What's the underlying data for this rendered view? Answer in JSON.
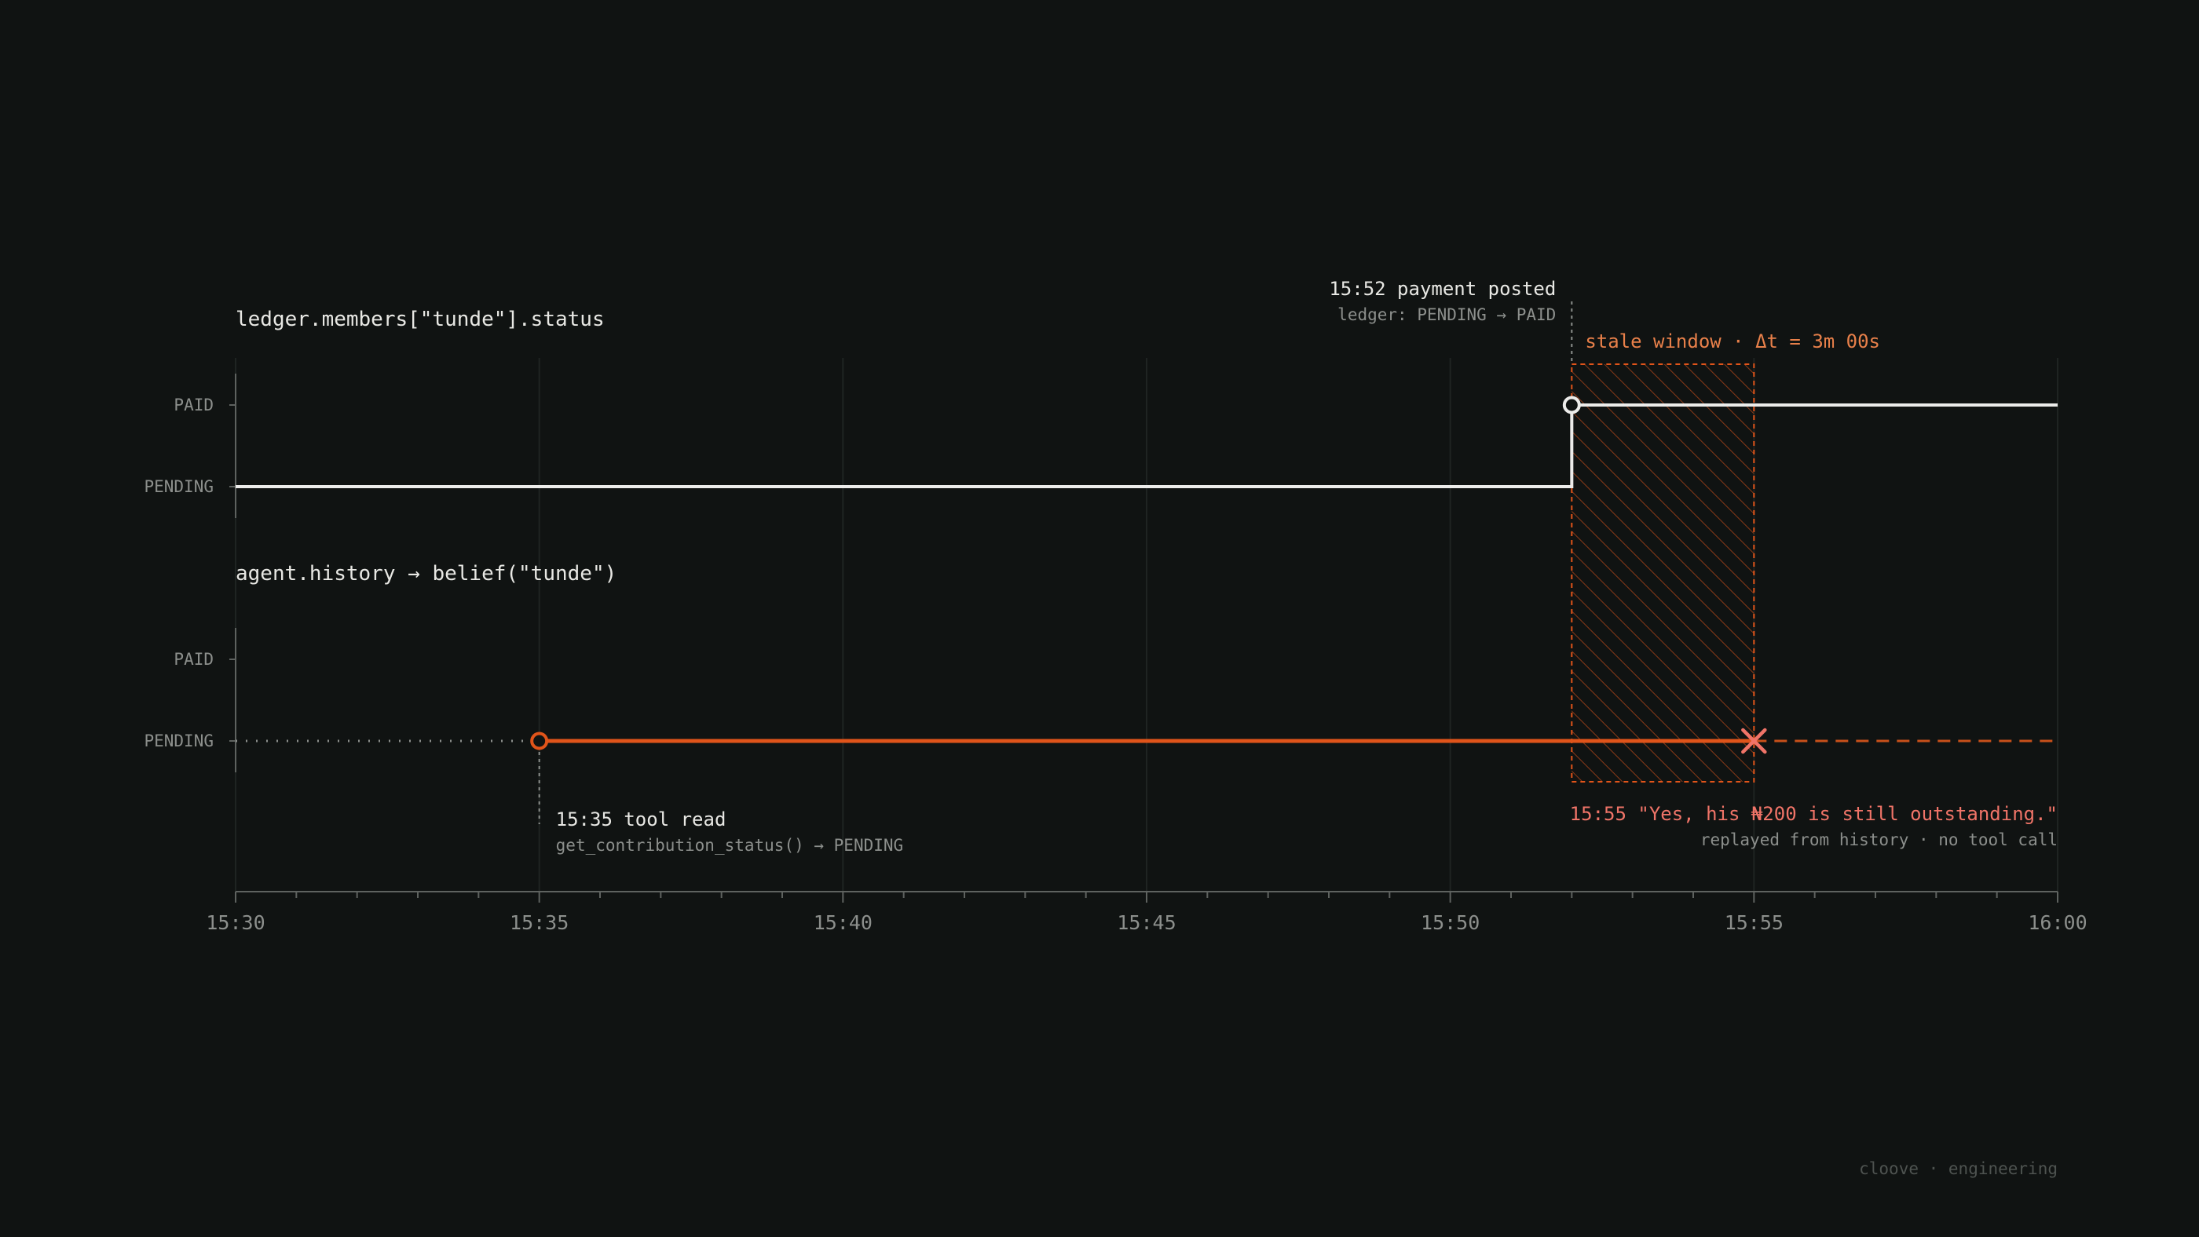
{
  "chart_data": {
    "type": "line",
    "x_unit": "time (HH:MM)",
    "xlim": [
      "15:30",
      "16:00"
    ],
    "x_ticks": [
      "15:30",
      "15:35",
      "15:40",
      "15:45",
      "15:50",
      "15:55",
      "16:00"
    ],
    "minor_tick_interval_minutes": 1,
    "grid": true,
    "y_levels": [
      "PENDING",
      "PAID"
    ],
    "panels": [
      {
        "title": "ledger.members[\"tunde\"].status",
        "series": [
          {
            "color": "#ececea",
            "style": "solid step",
            "points": [
              {
                "x": "15:30",
                "y": "PENDING"
              },
              {
                "x": "15:52",
                "y": "PENDING"
              },
              {
                "x": "15:52",
                "y": "PAID"
              },
              {
                "x": "16:00",
                "y": "PAID"
              }
            ]
          }
        ],
        "markers": [
          {
            "x": "15:52",
            "y": "PAID",
            "shape": "open-circle",
            "color": "#ececea"
          }
        ]
      },
      {
        "title": "agent.history → belief(\"tunde\")",
        "series": [
          {
            "color": "#8c8f8c",
            "style": "dotted",
            "points": [
              {
                "x": "15:30",
                "y": "PENDING"
              },
              {
                "x": "15:35",
                "y": "PENDING"
              }
            ]
          },
          {
            "color": "#e0541a",
            "style": "solid",
            "points": [
              {
                "x": "15:35",
                "y": "PENDING"
              },
              {
                "x": "15:55",
                "y": "PENDING"
              }
            ]
          },
          {
            "color": "#c8501a",
            "style": "dashed",
            "points": [
              {
                "x": "15:55",
                "y": "PENDING"
              },
              {
                "x": "16:00",
                "y": "PENDING"
              }
            ]
          }
        ],
        "markers": [
          {
            "x": "15:35",
            "y": "PENDING",
            "shape": "open-circle",
            "color": "#e0541a"
          },
          {
            "x": "15:55",
            "y": "PENDING",
            "shape": "x",
            "color": "#f07468"
          }
        ]
      }
    ],
    "stale_window": {
      "start": "15:52",
      "end": "15:55",
      "label": "stale window · Δt = 3m 00s",
      "color": "#e0541a"
    },
    "annotations": {
      "payment": {
        "x": "15:52",
        "title": "15:52 payment posted",
        "detail": "ledger: PENDING → PAID"
      },
      "tool_read": {
        "x": "15:35",
        "title": "15:35 tool read",
        "detail": "get_contribution_status() → PENDING"
      },
      "reply": {
        "x": "15:55",
        "title": "15:55 \"Yes, his ₦200 is still outstanding.\"",
        "detail": "replayed from history · no tool call"
      }
    }
  },
  "footer": {
    "brand": "cloove · engineering"
  }
}
